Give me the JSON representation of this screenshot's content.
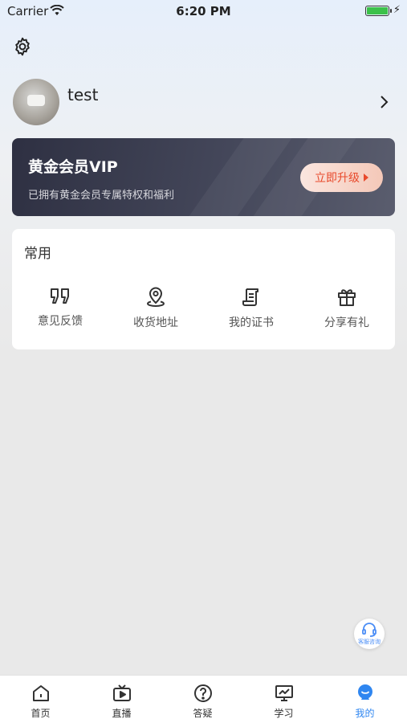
{
  "status_bar": {
    "carrier": "Carrier",
    "time": "6:20 PM"
  },
  "profile": {
    "username": "test"
  },
  "vip": {
    "title": "黄金会员VIP",
    "subtitle": "已拥有黄金会员专属特权和福利",
    "upgrade_label": "立即升级"
  },
  "common": {
    "title": "常用",
    "items": [
      {
        "label": "意见反馈",
        "icon": "quote-icon"
      },
      {
        "label": "收货地址",
        "icon": "location-pin-icon"
      },
      {
        "label": "我的证书",
        "icon": "certificate-icon"
      },
      {
        "label": "分享有礼",
        "icon": "gift-icon"
      }
    ]
  },
  "customer_service": {
    "label": "客服咨询"
  },
  "tabbar": {
    "items": [
      {
        "label": "首页",
        "icon": "home-icon"
      },
      {
        "label": "直播",
        "icon": "tv-icon"
      },
      {
        "label": "答疑",
        "icon": "question-icon"
      },
      {
        "label": "学习",
        "icon": "monitor-chart-icon"
      },
      {
        "label": "我的",
        "icon": "profile-icon"
      }
    ],
    "active_index": 4,
    "active_color": "#2f86f0"
  },
  "colors": {
    "accent": "#2f86f0",
    "vip_button_text": "#e8492b",
    "vip_card_bg": "#3a3d50"
  }
}
